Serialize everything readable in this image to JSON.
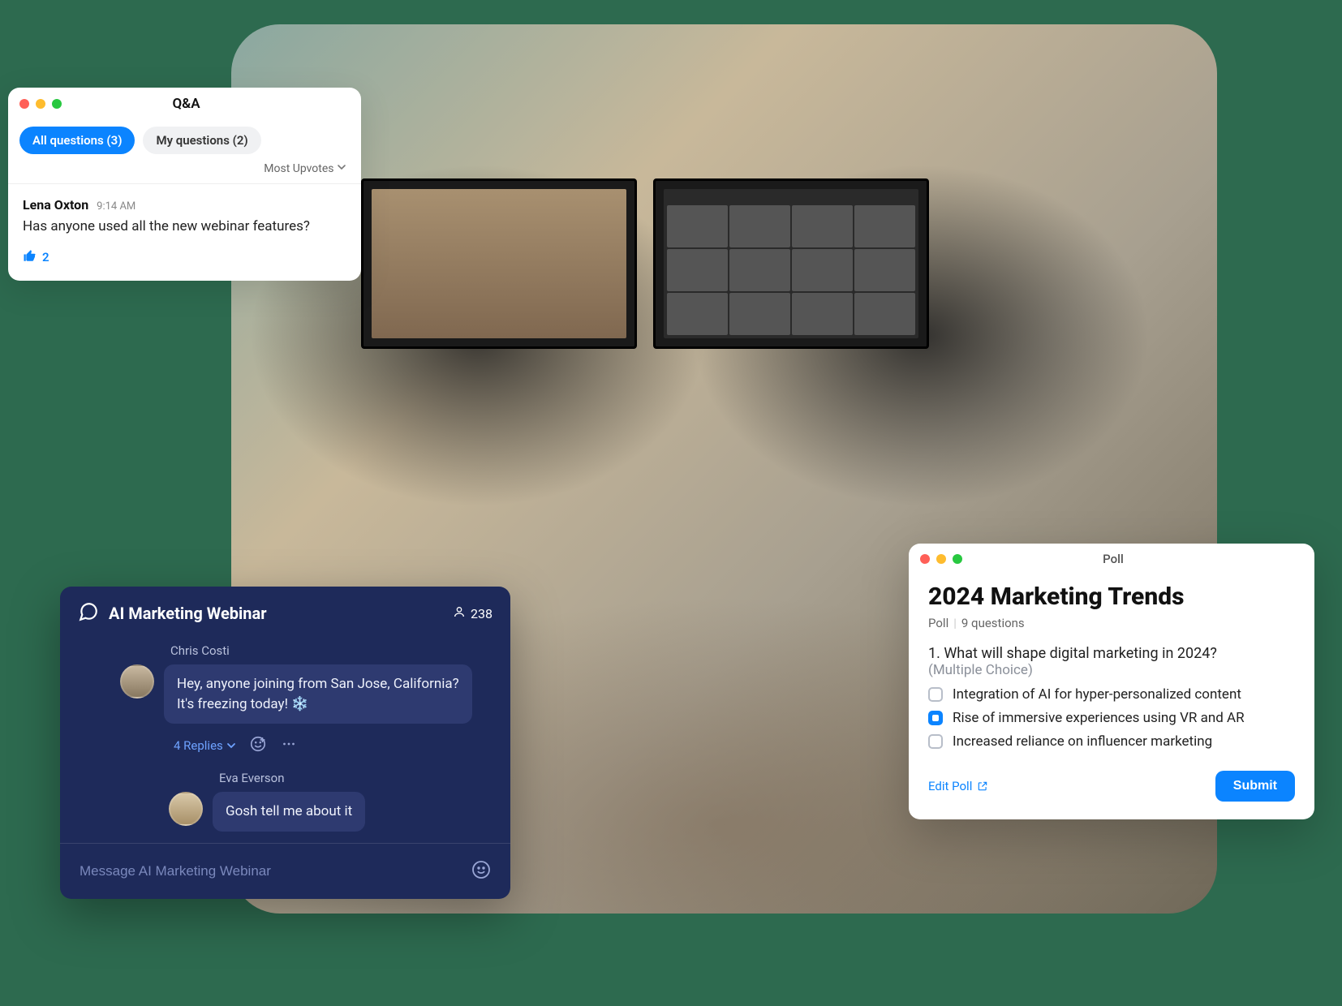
{
  "qa": {
    "title": "Q&A",
    "tabs": {
      "all": "All questions (3)",
      "mine": "My questions (2)"
    },
    "sort": "Most Upvotes",
    "question": {
      "author": "Lena Oxton",
      "time": "9:14 AM",
      "text": "Has anyone used all the new webinar features?",
      "likes": "2"
    }
  },
  "chat": {
    "title": "AI Marketing Webinar",
    "count": "238",
    "msg1": {
      "author": "Chris Costi",
      "text": "Hey, anyone joining from San Jose, California? It's freezing today! ❄️"
    },
    "replies": "4 Replies",
    "msg2": {
      "author": "Eva Everson",
      "text": "Gosh tell me about it"
    },
    "input_placeholder": "Message AI Marketing Webinar"
  },
  "poll": {
    "window_title": "Poll",
    "title": "2024 Marketing Trends",
    "sub_label": "Poll",
    "sub_count": "9 questions",
    "question": "1. What will shape digital marketing in 2024?",
    "hint": "(Multiple Choice)",
    "options": {
      "o1": "Integration of AI for hyper-personalized content",
      "o2": "Rise of immersive experiences using VR and AR",
      "o3": "Increased reliance on influencer marketing"
    },
    "edit": "Edit Poll",
    "submit": "Submit"
  }
}
